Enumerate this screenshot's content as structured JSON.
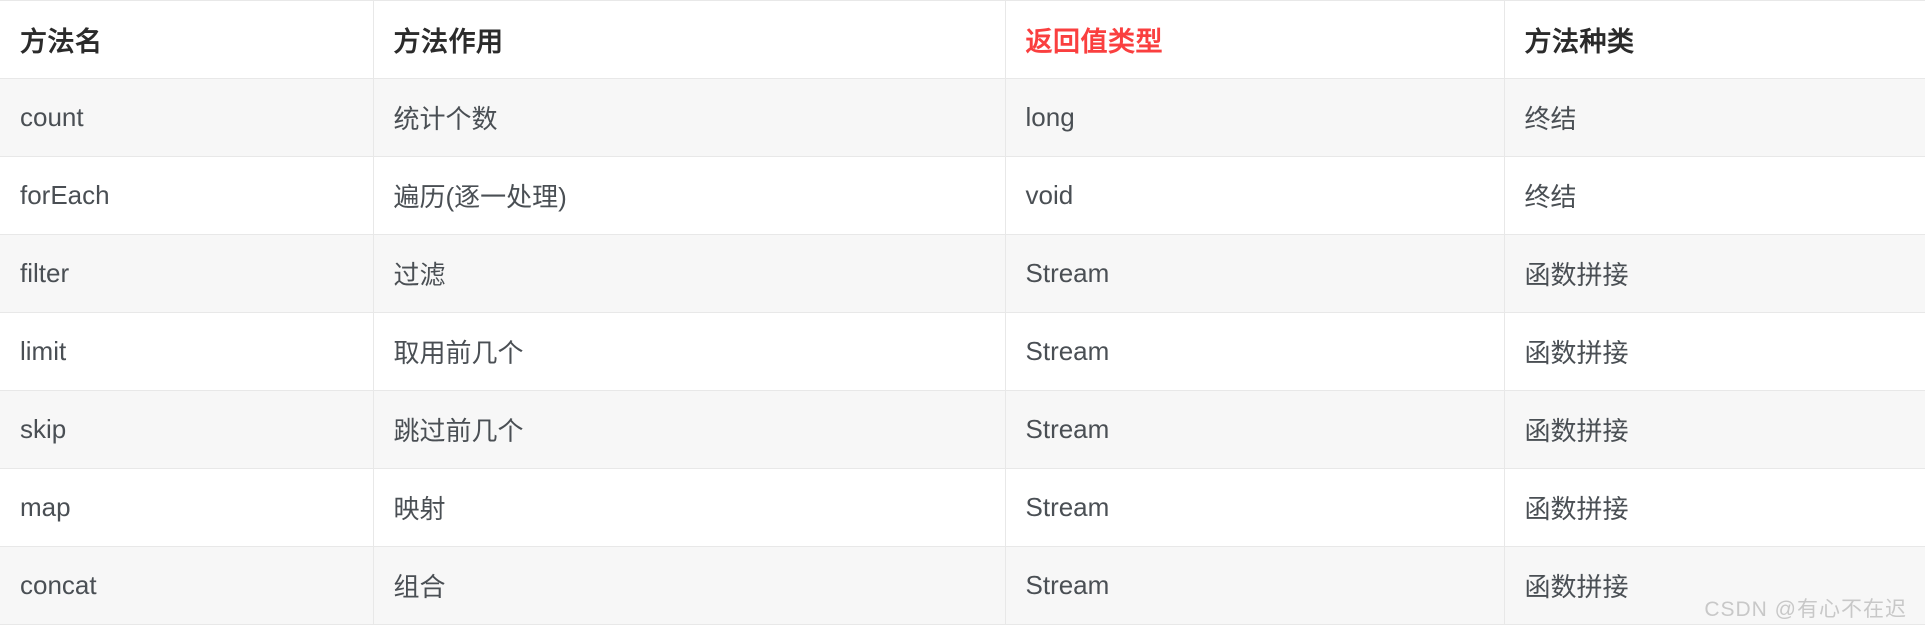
{
  "table": {
    "columns": [
      {
        "label": "方法名",
        "accent": false
      },
      {
        "label": "方法作用",
        "accent": false
      },
      {
        "label": "返回值类型",
        "accent": true
      },
      {
        "label": "方法种类",
        "accent": false
      }
    ],
    "accent_color": "#fa3f3f",
    "header_text_color": "#2b2b2b",
    "body_text_color": "#4a4f54",
    "stripe_color": "#f7f7f7",
    "border_color": "#e8e8e8",
    "rows": [
      {
        "method": "count",
        "purpose": "统计个数",
        "return_type": "long",
        "kind": "终结"
      },
      {
        "method": "forEach",
        "purpose": "遍历(逐一处理)",
        "return_type": "void",
        "kind": "终结"
      },
      {
        "method": "filter",
        "purpose": "过滤",
        "return_type": "Stream",
        "kind": "函数拼接"
      },
      {
        "method": "limit",
        "purpose": "取用前几个",
        "return_type": "Stream",
        "kind": "函数拼接"
      },
      {
        "method": "skip",
        "purpose": "跳过前几个",
        "return_type": "Stream",
        "kind": "函数拼接"
      },
      {
        "method": "map",
        "purpose": "映射",
        "return_type": "Stream",
        "kind": "函数拼接"
      },
      {
        "method": "concat",
        "purpose": "组合",
        "return_type": "Stream",
        "kind": "函数拼接"
      }
    ]
  },
  "watermark": {
    "text": "CSDN @有心不在迟"
  }
}
